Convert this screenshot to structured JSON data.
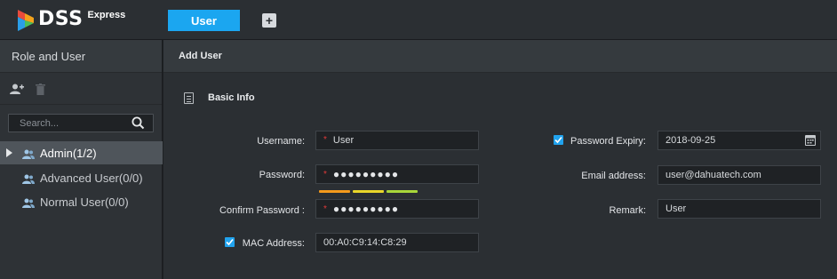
{
  "app": {
    "logo_text": "DSS",
    "logo_sub": "Express",
    "active_tab": "User",
    "add_tab_label": "+"
  },
  "sidebar": {
    "title": "Role and User",
    "search_placeholder": "Search...",
    "items": [
      {
        "label": "Admin(1/2)",
        "selected": true,
        "expandable": true
      },
      {
        "label": "Advanced User(0/0)",
        "selected": false,
        "expandable": false
      },
      {
        "label": "Normal User(0/0)",
        "selected": false,
        "expandable": false
      }
    ],
    "tool_icons": [
      "add-user-icon",
      "delete-icon"
    ]
  },
  "main": {
    "title": "Add User",
    "section_title": "Basic Info",
    "form": {
      "username_label": "Username:",
      "username_value": "User",
      "password_label": "Password:",
      "password_value": "●●●●●●●●●",
      "confirm_label": "Confirm Password :",
      "confirm_value": "●●●●●●●●●",
      "mac_label": "MAC Address:",
      "mac_value": "00:A0:C9:14:C8:29",
      "mac_checked": true,
      "expiry_label": "Password Expiry:",
      "expiry_value": "2018-09-25",
      "expiry_checked": true,
      "email_label": "Email address:",
      "email_value": "user@dahuatech.com",
      "remark_label": "Remark:",
      "remark_value": "User",
      "required_marker": "*"
    },
    "password_strength_colors": [
      "#f59a1c",
      "#e9d62a",
      "#a8d63a"
    ]
  },
  "colors": {
    "accent": "#1ba6f0",
    "required": "#e23a3a"
  }
}
